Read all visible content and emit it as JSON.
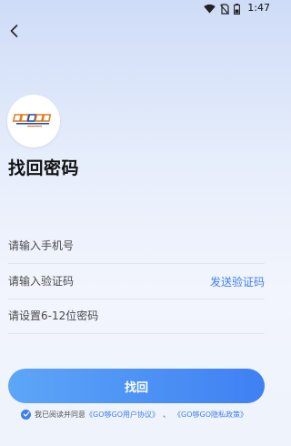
{
  "status": {
    "time": "1:47"
  },
  "page": {
    "title": "找回密码"
  },
  "form": {
    "phone_placeholder": "请输入手机号",
    "code_placeholder": "请输入验证码",
    "send_code_label": "发送验证码",
    "password_placeholder": "请设置6-12位密码",
    "submit_label": "找回"
  },
  "agreement": {
    "prefix": "我已阅读并同意",
    "user_agreement": "《GO够GO用户协议》",
    "separator": "、",
    "privacy_policy": "《GO够GO隐私政策》"
  },
  "icons": {
    "back": "back-arrow-icon",
    "check": "checkbox-checked-icon",
    "wifi": "wifi-icon",
    "sim": "no-sim-icon",
    "battery": "battery-icon"
  },
  "colors": {
    "accent": "#3d7ff0",
    "button_start": "#5ca6f7",
    "button_end": "#3f80f3"
  }
}
